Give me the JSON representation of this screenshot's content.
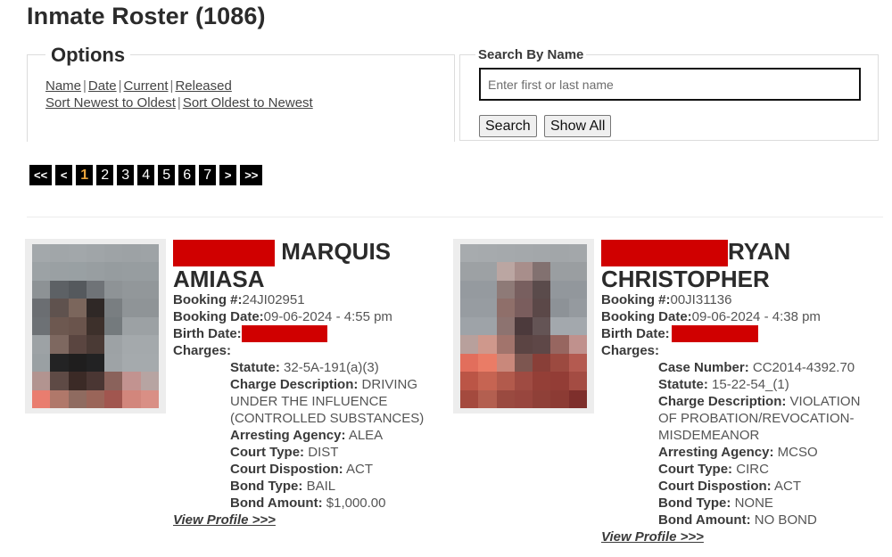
{
  "page": {
    "title": "Inmate Roster (1086)"
  },
  "options": {
    "legend": "Options",
    "filter_links": [
      "Name",
      "Date",
      "Current",
      "Released"
    ],
    "sort_links": [
      "Sort Newest to Oldest",
      "Sort Oldest to Newest"
    ],
    "separator": "|"
  },
  "search": {
    "legend": "Search By Name",
    "input_value": "",
    "placeholder": "Enter first or last name",
    "search_label": "Search",
    "show_all_label": "Show All"
  },
  "pagination": {
    "first": "<<",
    "prev": "<",
    "pages": [
      "1",
      "2",
      "3",
      "4",
      "5",
      "6",
      "7"
    ],
    "current_page": "1",
    "next": ">",
    "last": ">>",
    "active_color": "#e8a33c"
  },
  "inmates": [
    {
      "name_visible_part1": "MARQUIS",
      "name_visible_part2": "AMIASA",
      "last_name_redacted": true,
      "booking_number_label": "Booking #:",
      "booking_number": "24JI02951",
      "booking_date_label": "Booking Date:",
      "booking_date": "09-06-2024 - 4:55 pm",
      "birth_date_label": "Birth Date:",
      "birth_date_redacted": true,
      "charges_label": "Charges:",
      "charges": [
        {
          "label": "Statute:",
          "value": "32-5A-191(a)(3)"
        },
        {
          "label": "Charge Description:",
          "value": "DRIVING UNDER THE INFLUENCE (CONTROLLED SUBSTANCES)"
        },
        {
          "label": "Arresting Agency:",
          "value": "ALEA"
        },
        {
          "label": "Court Type:",
          "value": "DIST"
        },
        {
          "label": "Court Dispostion:",
          "value": "ACT"
        },
        {
          "label": "Bond Type:",
          "value": "BAIL"
        },
        {
          "label": "Bond Amount:",
          "value": "$1,000.00"
        }
      ],
      "profile_link": "View Profile >>>"
    },
    {
      "name_visible_part1": "RYAN",
      "name_visible_part2": "CHRISTOPHER",
      "last_name_redacted": true,
      "booking_number_label": "Booking #:",
      "booking_number": "00JI31136",
      "booking_date_label": "Booking Date:",
      "booking_date": "09-06-2024 - 4:38 pm",
      "birth_date_label": "Birth Date:",
      "birth_date_redacted": true,
      "charges_label": "Charges:",
      "charges": [
        {
          "label": "Case Number:",
          "value": "CC2014-4392.70"
        },
        {
          "label": "Statute:",
          "value": "15-22-54_(1)"
        },
        {
          "label": "Charge Description:",
          "value": "VIOLATION OF PROBATION/REVOCATION-MISDEMEANOR"
        },
        {
          "label": "Arresting Agency:",
          "value": "MCSO"
        },
        {
          "label": "Court Type:",
          "value": "CIRC"
        },
        {
          "label": "Court Dispostion:",
          "value": "ACT"
        },
        {
          "label": "Bond Type:",
          "value": "NONE"
        },
        {
          "label": "Bond Amount:",
          "value": "NO BOND"
        }
      ],
      "profile_link": "View Profile >>>"
    }
  ],
  "colors": {
    "redaction": "#d00000",
    "pager_bg": "#000000"
  }
}
